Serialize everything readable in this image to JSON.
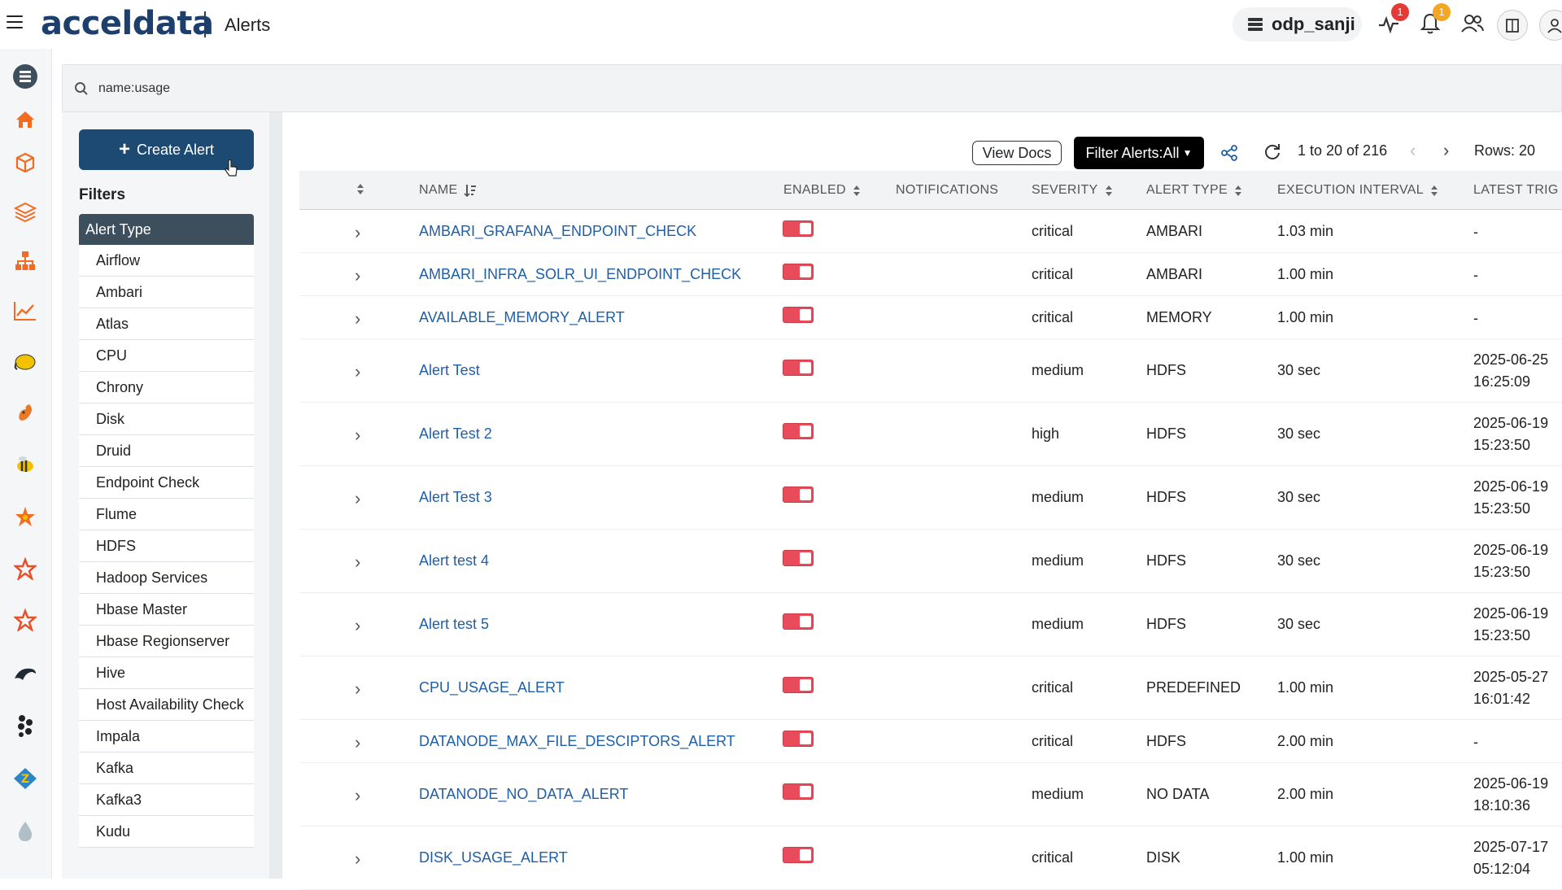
{
  "header": {
    "logo": "acceldata",
    "page_title": "Alerts",
    "cluster": "odp_sanji",
    "activity_badge": "1",
    "notification_badge": "1"
  },
  "search": {
    "value": "name:usage"
  },
  "sidebar": {
    "create_label": "Create Alert",
    "filters_title": "Filters",
    "filter_group": "Alert Type",
    "items": [
      "Airflow",
      "Ambari",
      "Atlas",
      "CPU",
      "Chrony",
      "Disk",
      "Druid",
      "Endpoint Check",
      "Flume",
      "HDFS",
      "Hadoop Services",
      "Hbase Master",
      "Hbase Regionserver",
      "Hive",
      "Host Availability Check",
      "Impala",
      "Kafka",
      "Kafka3",
      "Kudu"
    ]
  },
  "toolbar": {
    "view_docs": "View Docs",
    "filter_alerts": "Filter Alerts:All",
    "page_range": "1 to 20 of 216",
    "rows": "Rows: 20"
  },
  "table": {
    "columns": {
      "name": "NAME",
      "enabled": "ENABLED",
      "notifications": "NOTIFICATIONS",
      "severity": "SEVERITY",
      "alert_type": "ALERT TYPE",
      "execution_interval": "EXECUTION INTERVAL",
      "latest": "LATEST TRIG"
    },
    "rows": [
      {
        "name": "AMBARI_GRAFANA_ENDPOINT_CHECK",
        "severity": "critical",
        "type": "AMBARI",
        "interval": "1.03 min",
        "latest": "-"
      },
      {
        "name": "AMBARI_INFRA_SOLR_UI_ENDPOINT_CHECK",
        "severity": "critical",
        "type": "AMBARI",
        "interval": "1.00 min",
        "latest": "-"
      },
      {
        "name": "AVAILABLE_MEMORY_ALERT",
        "severity": "critical",
        "type": "MEMORY",
        "interval": "1.00 min",
        "latest": "-"
      },
      {
        "name": "Alert Test",
        "severity": "medium",
        "type": "HDFS",
        "interval": "30 sec",
        "latest": "2025-06-25\n16:25:09"
      },
      {
        "name": "Alert Test 2",
        "severity": "high",
        "type": "HDFS",
        "interval": "30 sec",
        "latest": "2025-06-19\n15:23:50"
      },
      {
        "name": "Alert Test 3",
        "severity": "medium",
        "type": "HDFS",
        "interval": "30 sec",
        "latest": "2025-06-19\n15:23:50"
      },
      {
        "name": "Alert test 4",
        "severity": "medium",
        "type": "HDFS",
        "interval": "30 sec",
        "latest": "2025-06-19\n15:23:50"
      },
      {
        "name": "Alert test 5",
        "severity": "medium",
        "type": "HDFS",
        "interval": "30 sec",
        "latest": "2025-06-19\n15:23:50"
      },
      {
        "name": "CPU_USAGE_ALERT",
        "severity": "critical",
        "type": "PREDEFINED",
        "interval": "1.00 min",
        "latest": "2025-05-27\n16:01:42"
      },
      {
        "name": "DATANODE_MAX_FILE_DESCIPTORS_ALERT",
        "severity": "critical",
        "type": "HDFS",
        "interval": "2.00 min",
        "latest": "-"
      },
      {
        "name": "DATANODE_NO_DATA_ALERT",
        "severity": "medium",
        "type": "NO DATA",
        "interval": "2.00 min",
        "latest": "2025-06-19\n18:10:36"
      },
      {
        "name": "DISK_USAGE_ALERT",
        "severity": "critical",
        "type": "DISK",
        "interval": "1.00 min",
        "latest": "2025-07-17\n05:12:04"
      }
    ]
  },
  "colors": {
    "brand": "#1d3f6e",
    "create_button": "#1c4a73",
    "link": "#1f5fa8",
    "toggle": "#e84c5a",
    "badge_red": "#e53935",
    "badge_orange": "#f5a623"
  },
  "rail_icons": [
    "database-icon",
    "home-icon",
    "cube-icon",
    "layers-icon",
    "hierarchy-icon",
    "chart-icon",
    "hadoop-elephant-icon",
    "squirrel-icon",
    "bee-icon",
    "star-icon",
    "spark-icon",
    "spark-alt-icon",
    "dolphin-icon",
    "cluster-dots-icon",
    "zookeeper-icon",
    "drop-icon"
  ]
}
